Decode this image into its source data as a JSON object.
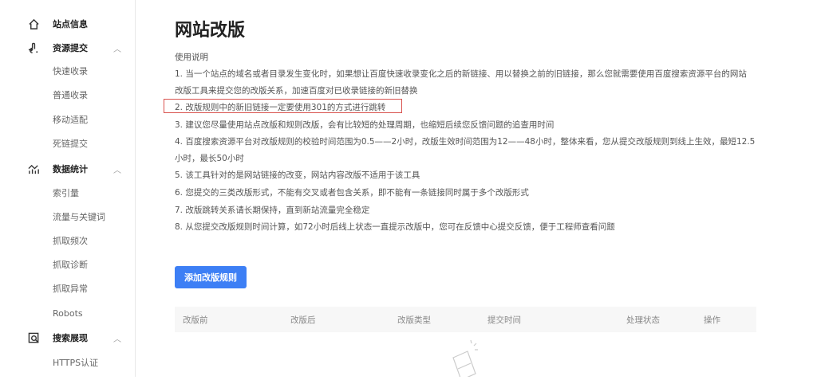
{
  "sidebar": {
    "items": [
      {
        "label": "站点信息",
        "type": "group",
        "icon": "home-icon"
      },
      {
        "label": "资源提交",
        "type": "group",
        "icon": "submit-icon",
        "expanded": true
      },
      {
        "label": "快速收录",
        "type": "sub"
      },
      {
        "label": "普通收录",
        "type": "sub"
      },
      {
        "label": "移动适配",
        "type": "sub"
      },
      {
        "label": "死链提交",
        "type": "sub"
      },
      {
        "label": "数据统计",
        "type": "group",
        "icon": "chart-icon",
        "expanded": true
      },
      {
        "label": "索引量",
        "type": "sub"
      },
      {
        "label": "流量与关键词",
        "type": "sub"
      },
      {
        "label": "抓取频次",
        "type": "sub"
      },
      {
        "label": "抓取诊断",
        "type": "sub"
      },
      {
        "label": "抓取异常",
        "type": "sub"
      },
      {
        "label": "Robots",
        "type": "sub"
      },
      {
        "label": "搜索展现",
        "type": "group",
        "icon": "search-display-icon",
        "expanded": true
      },
      {
        "label": "HTTPS认证",
        "type": "sub"
      }
    ]
  },
  "main": {
    "title": "网站改版",
    "instructions_heading": "使用说明",
    "lines": [
      "1. 当一个站点的域名或者目录发生变化时，如果想让百度快速收录变化之后的新链接、用以替换之前的旧链接，那么您就需要使用百度搜索资源平台的网站",
      "改版工具来提交您的改版关系，加速百度对已收录链接的新旧替换",
      "2. 改版规则中的新旧链接一定要使用301的方式进行跳转",
      "3. 建议您尽量使用站点改版和规则改版，会有比较短的处理周期，也缩短后续您反馈问题的追查用时间",
      "4. 百度搜索资源平台对改版规则的校验时间范围为0.5——2小时，改版生效时间范围为12——48小时，整体来看，您从提交改版规则到线上生效，最短12.5",
      "小时，最长50小时",
      "5. 该工具针对的是网站链接的改变，网站内容改版不适用于该工具",
      "6. 您提交的三类改版形式，不能有交叉或者包含关系，即不能有一条链接同时属于多个改版形式",
      "7. 改版跳转关系请长期保持，直到新站流量完全稳定",
      "8. 从您提交改版规则时间计算，如72小时后线上状态一直提示改版中，您可在反馈中心提交反馈，便于工程师查看问题"
    ],
    "add_button": "添加改版规则",
    "table_headers": [
      "改版前",
      "改版后",
      "改版类型",
      "提交时间",
      "处理状态",
      "操作"
    ]
  },
  "colors": {
    "accent": "#3d7ff5",
    "highlight_border": "#d9534f"
  }
}
